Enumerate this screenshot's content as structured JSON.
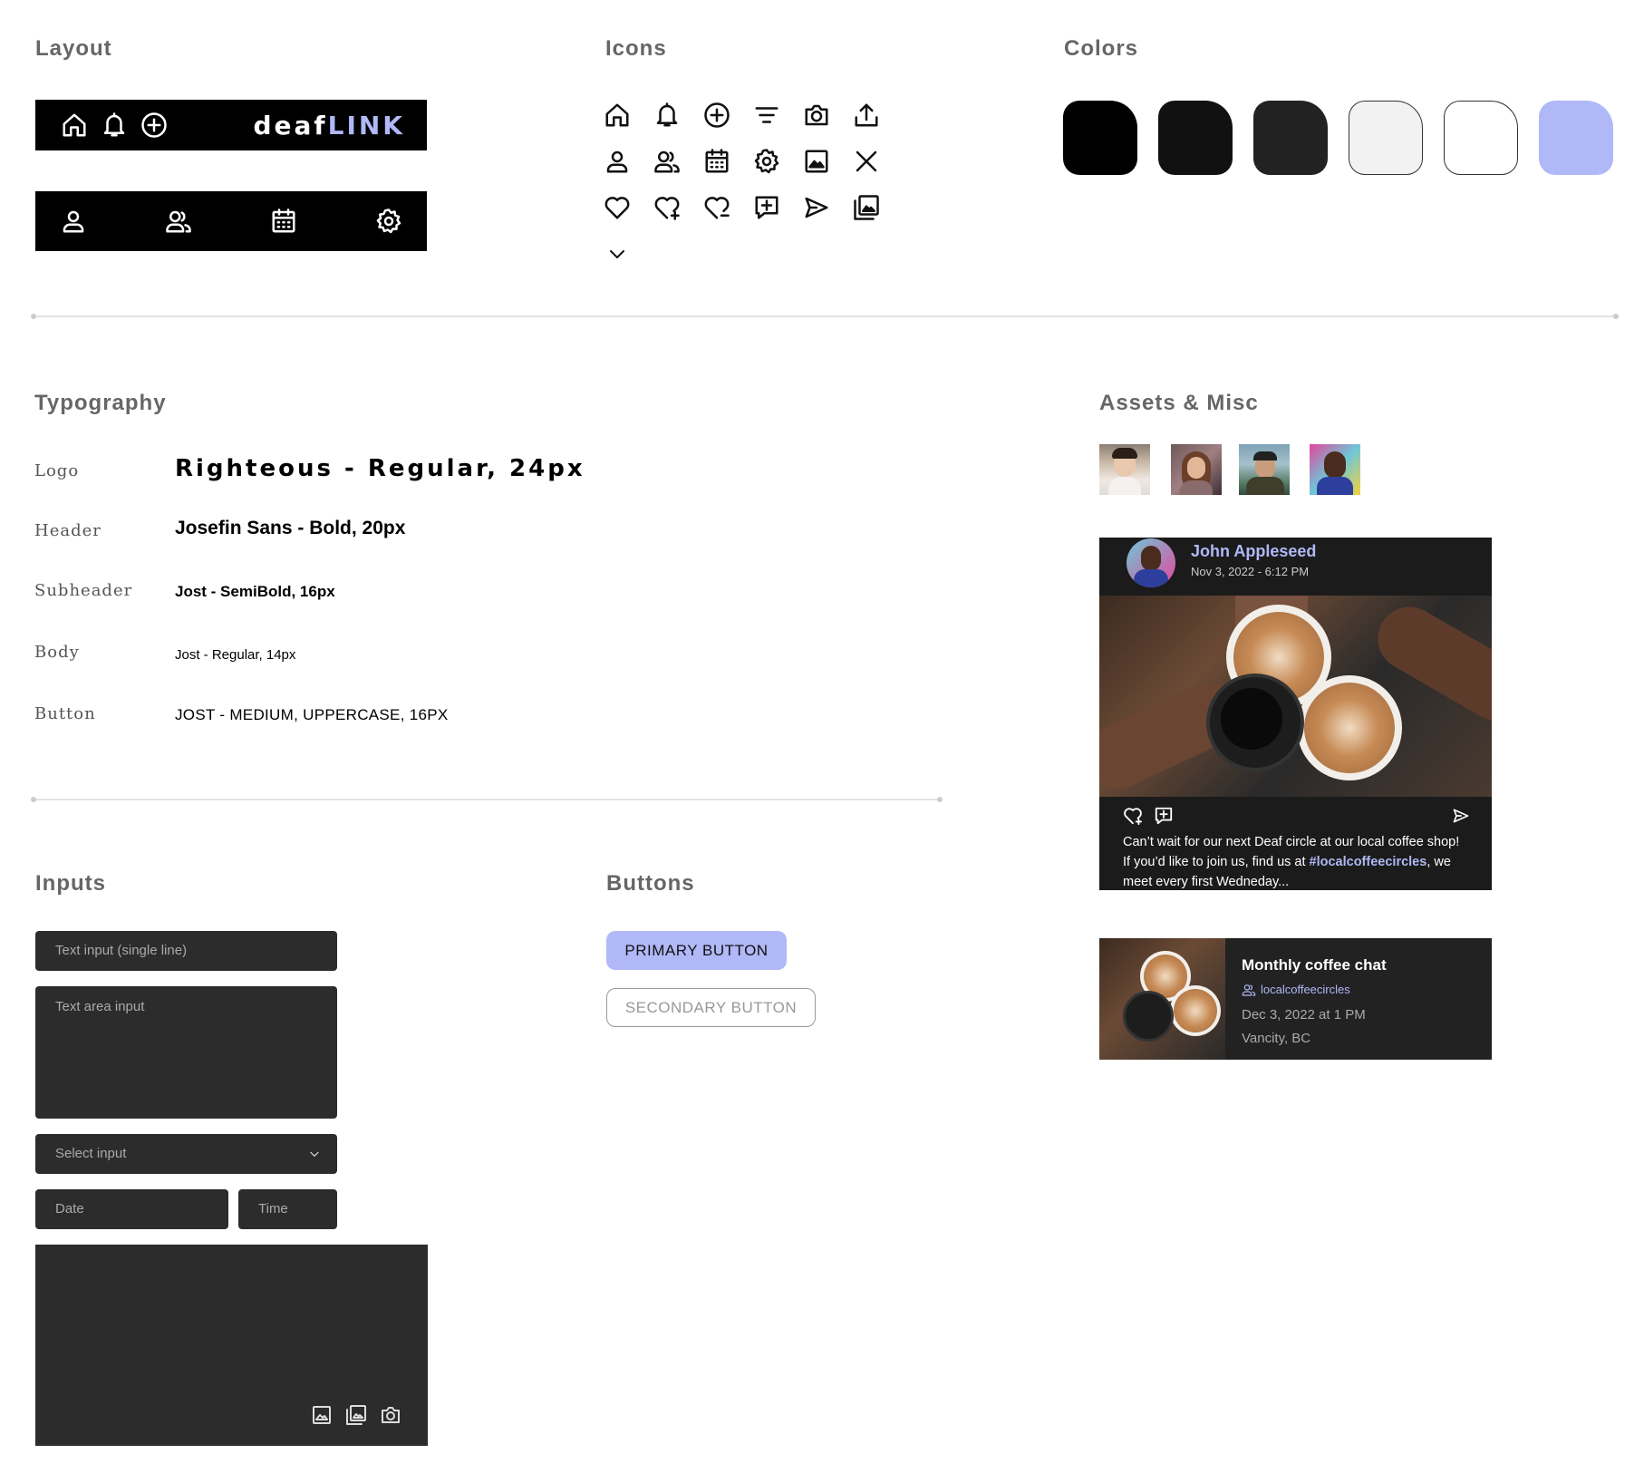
{
  "sections": {
    "layout": "Layout",
    "icons": "Icons",
    "colors": "Colors",
    "typography": "Typography",
    "assets": "Assets & Misc",
    "inputs": "Inputs",
    "buttons": "Buttons"
  },
  "layout": {
    "logo_main": "deaf",
    "logo_accent": "LINK",
    "top_icons": [
      "home-icon",
      "bell-icon",
      "plus-circle-icon"
    ],
    "bottom_icons": [
      "user-icon",
      "users-icon",
      "calendar-icon",
      "gear-icon"
    ]
  },
  "icons": [
    "home-icon",
    "bell-icon",
    "plus-circle-icon",
    "filter-icon",
    "camera-icon",
    "upload-icon",
    "user-icon",
    "users-icon",
    "calendar-icon",
    "gear-icon",
    "image-icon",
    "close-icon",
    "heart-icon",
    "heart-plus-icon",
    "heart-minus-icon",
    "comment-plus-icon",
    "send-icon",
    "gallery-icon",
    "chevron-down-icon"
  ],
  "colors": [
    "#000000",
    "#111111",
    "#222222",
    "#f2f2f2",
    "#ffffff",
    "#b0b8f7"
  ],
  "typography": {
    "rows": [
      {
        "label": "Logo",
        "sample": "Righteous - Regular, 24px"
      },
      {
        "label": "Header",
        "sample": "Josefin Sans - Bold, 20px"
      },
      {
        "label": "Subheader",
        "sample": "Jost - SemiBold, 16px"
      },
      {
        "label": "Body",
        "sample": "Jost - Regular, 14px"
      },
      {
        "label": "Button",
        "sample": "JOST - MEDIUM, UPPERCASE, 16PX"
      }
    ]
  },
  "inputs": {
    "text_placeholder": "Text input (single line)",
    "textarea_placeholder": "Text area input",
    "select_placeholder": "Select input",
    "date_placeholder": "Date",
    "time_placeholder": "Time"
  },
  "buttons": {
    "primary": "PRIMARY BUTTON",
    "secondary": "SECONDARY BUTTON"
  },
  "post": {
    "author": "John Appleseed",
    "timestamp": "Nov 3, 2022 - 6:12 PM",
    "caption_prefix": "Can’t wait for our next Deaf circle at our local coffee shop! If you’d like to join us, find us at ",
    "hashtag": "#localcoffeecircles",
    "caption_suffix": ", we meet every first Wedneday..."
  },
  "event": {
    "title": "Monthly coffee chat",
    "group": "localcoffeecircles",
    "date": "Dec 3, 2022 at 1 PM",
    "location": "Vancity, BC"
  }
}
